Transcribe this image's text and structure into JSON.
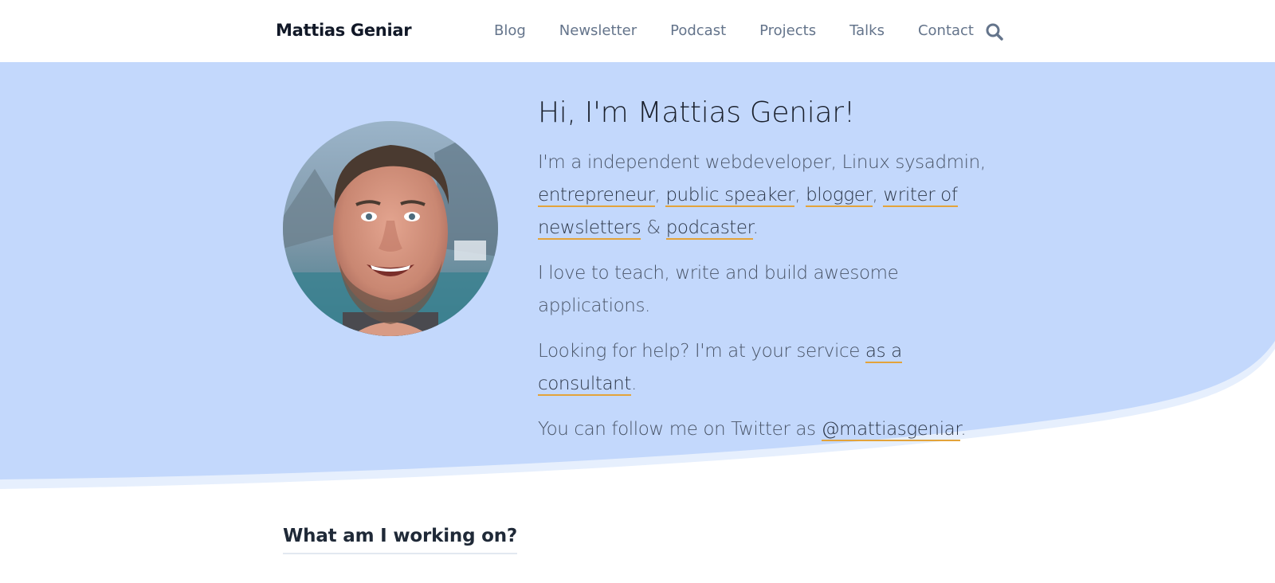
{
  "nav": {
    "brand": "Mattias Geniar",
    "items": [
      {
        "label": "Blog"
      },
      {
        "label": "Newsletter"
      },
      {
        "label": "Podcast"
      },
      {
        "label": "Projects"
      },
      {
        "label": "Talks"
      },
      {
        "label": "Contact"
      }
    ],
    "search_icon": "search-icon"
  },
  "hero": {
    "title": "Hi, I'm Mattias Geniar!",
    "p1": {
      "prefix": "I'm a independent webdeveloper, Linux sysadmin,",
      "link_entrepreneur": "entrepreneur",
      "link_speaker": "public speaker",
      "link_blogger": "blogger",
      "link_writer": "writer of newsletters",
      "amp": "&",
      "link_podcaster": "podcaster",
      "comma": ",",
      "period": "."
    },
    "p2": "I love to teach, write and build awesome applications.",
    "p3": {
      "prefix": "Looking for help? I'm at your service",
      "link": "as a consultant",
      "suffix": "."
    },
    "p4": {
      "prefix": "You can follow me on Twitter as",
      "link": "@mattiasgeniar",
      "suffix": "."
    },
    "avatar_alt": "avatar"
  },
  "section": {
    "title": "What am I working on?"
  },
  "colors": {
    "hero_bg": "#c3d8fc",
    "hero_wave": "#e6effd",
    "link_underline": "#e3a33a"
  }
}
